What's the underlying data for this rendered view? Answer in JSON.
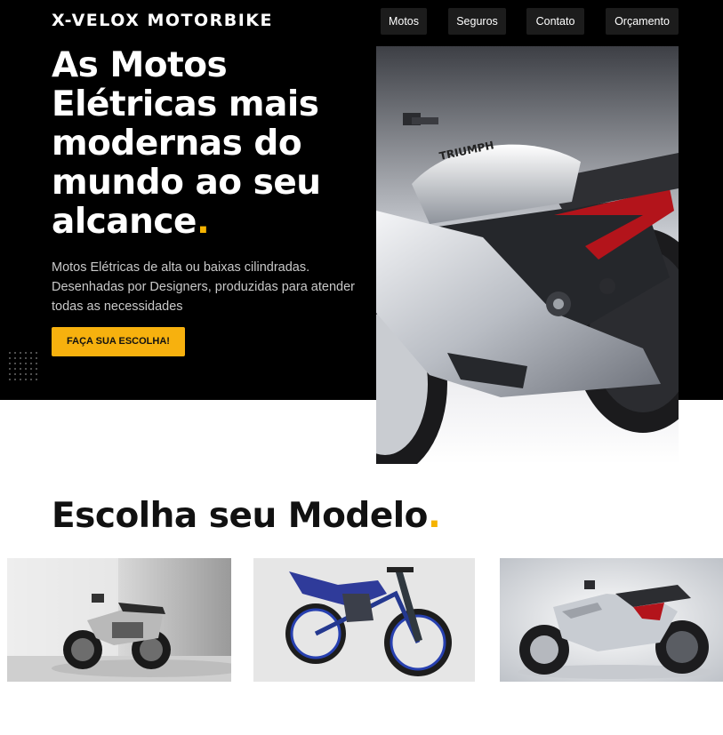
{
  "header": {
    "logo_text": "X-VELOX  MOTORBIKE",
    "nav": [
      {
        "label": "Motos"
      },
      {
        "label": "Seguros"
      },
      {
        "label": "Contato"
      },
      {
        "label": "Orçamento"
      }
    ]
  },
  "hero": {
    "headline": "As Motos Elétricas mais modernas do mundo ao seu alcance",
    "headline_dot": ".",
    "subtitle": "Motos Elétricas de alta ou baixas cilindradas. Desenhadas por Designers, produzidas para atender todas as necessidades",
    "cta_label": "FAÇA SUA ESCOLHA!",
    "image_brand_text": "TRIUMPH"
  },
  "models": {
    "title": "Escolha seu Modelo",
    "title_dot": ".",
    "cards": [
      {
        "image": "silver-electric-motorcycle-photo"
      },
      {
        "image": "blue-trial-motorcycle-photo"
      },
      {
        "image": "triumph-electric-concept-sketch"
      }
    ]
  },
  "colors": {
    "accent": "#f5b301",
    "hero_bg": "#000000",
    "nav_bg": "#1c1c1c"
  }
}
